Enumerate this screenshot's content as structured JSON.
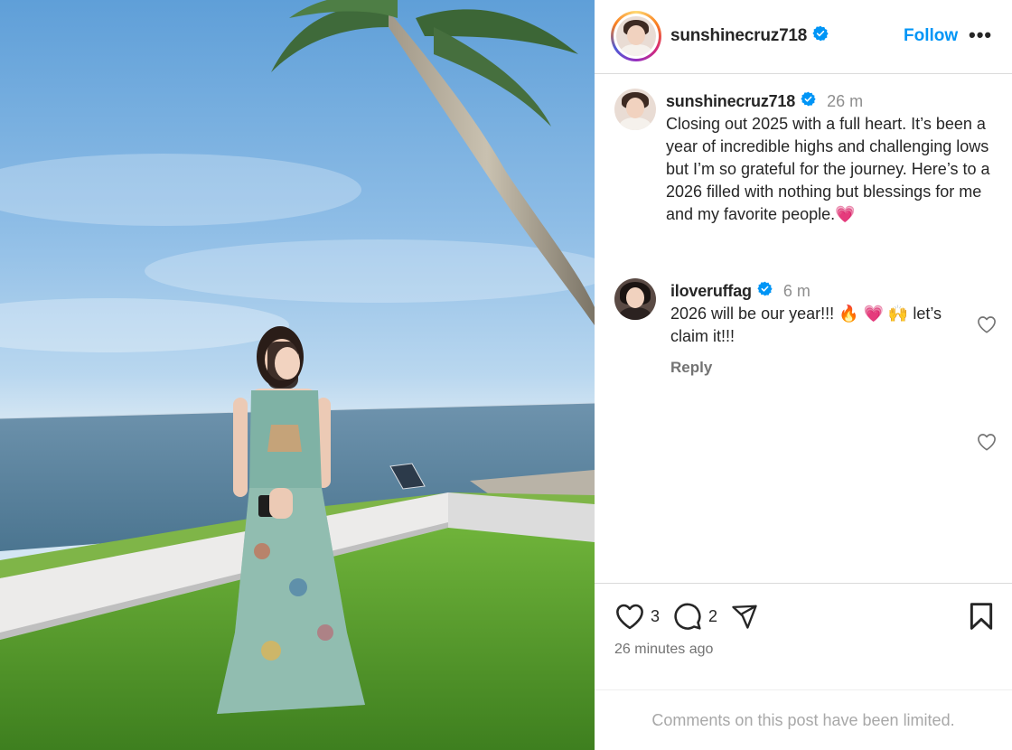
{
  "header": {
    "username": "sunshinecruz718",
    "follow_label": "Follow",
    "more_label": "•••"
  },
  "caption": {
    "username": "sunshinecruz718",
    "time": "26 m",
    "text": "Closing out 2025 with a full heart. It’s been a year of incredible highs and challenging lows but I’m so grateful for the journey. Here’s to a 2026 filled with nothing but blessings for me and my favorite people.💗"
  },
  "comment": {
    "username": "iloveruffag",
    "time": "6 m",
    "text": "2026 will be our year!!! 🔥 💗 🙌 let’s claim it!!!",
    "reply_label": "Reply"
  },
  "actions": {
    "like_count": "3",
    "comment_count": "2",
    "posted_ago": "26 minutes ago"
  },
  "footer": {
    "limited_text": "Comments on this post have been limited."
  },
  "icons": [
    "verified-badge-icon",
    "heart-icon",
    "comment-icon",
    "share-icon",
    "bookmark-icon",
    "more-icon"
  ],
  "colors": {
    "accent": "#0095f6",
    "text": "#262626",
    "muted": "#737373",
    "heart_emoji": "#e8336d"
  }
}
